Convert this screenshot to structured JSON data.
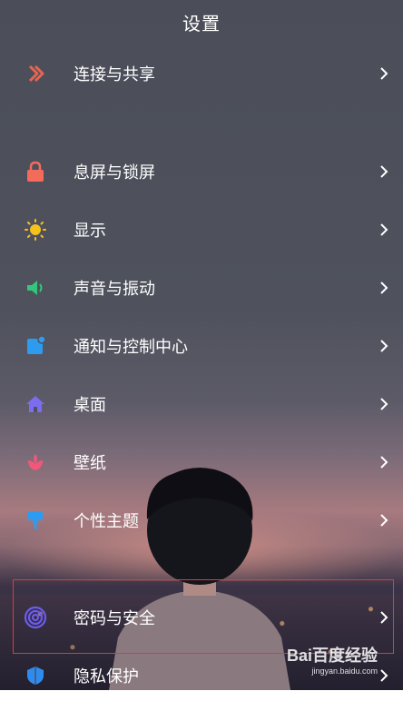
{
  "header": {
    "title": "设置"
  },
  "settings_items": [
    {
      "label": "连接与共享",
      "icon": "connection-share-icon",
      "color": "#e8654f"
    },
    {
      "label": "息屏与锁屏",
      "icon": "lock-icon",
      "color": "#f26b5b"
    },
    {
      "label": "显示",
      "icon": "sun-icon",
      "color": "#f5c21b"
    },
    {
      "label": "声音与振动",
      "icon": "speaker-icon",
      "color": "#34c77b"
    },
    {
      "label": "通知与控制中心",
      "icon": "notification-icon",
      "color": "#2d9cf0"
    },
    {
      "label": "桌面",
      "icon": "home-icon",
      "color": "#7b6cf0"
    },
    {
      "label": "壁纸",
      "icon": "tulip-icon",
      "color": "#f0577a"
    },
    {
      "label": "个性主题",
      "icon": "theme-brush-icon",
      "color": "#2d9cf0"
    },
    {
      "label": "密码与安全",
      "icon": "fingerprint-icon",
      "color": "#6b5cf0"
    },
    {
      "label": "隐私保护",
      "icon": "privacy-shield-icon",
      "color": "#2d8cf0"
    }
  ],
  "highlight_color": "#e03a3a",
  "watermark": {
    "logo": "Bai百度经验",
    "url": "jingyan.baidu.com"
  }
}
